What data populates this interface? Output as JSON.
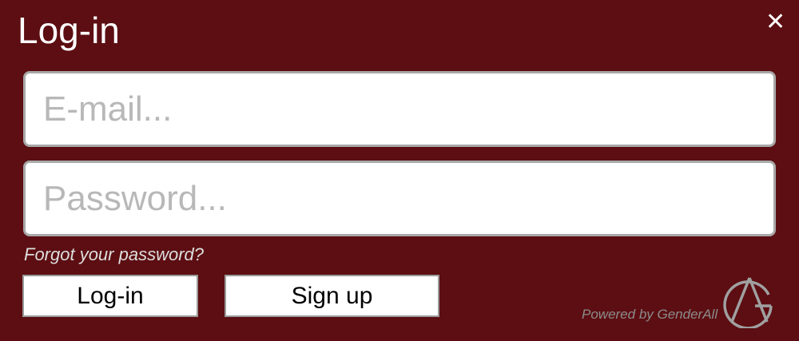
{
  "dialog": {
    "title": "Log-in",
    "close_icon": "close-icon",
    "close_glyph": "✕"
  },
  "form": {
    "email_placeholder": "E-mail...",
    "email_value": "",
    "password_placeholder": "Password...",
    "password_value": "",
    "forgot_password": "Forgot your password?",
    "login_label": "Log-in",
    "signup_label": "Sign up"
  },
  "footer": {
    "powered_by": "Powered by GenderAll",
    "logo_icon": "genderall-logo-icon"
  },
  "colors": {
    "background": "#5c0e12",
    "title": "#ffffff",
    "input_border": "#a8a8a8",
    "placeholder": "#b8b8b8",
    "link": "#dedede",
    "powered_text": "#8c8c8c",
    "logo": "#a0a0a0"
  }
}
